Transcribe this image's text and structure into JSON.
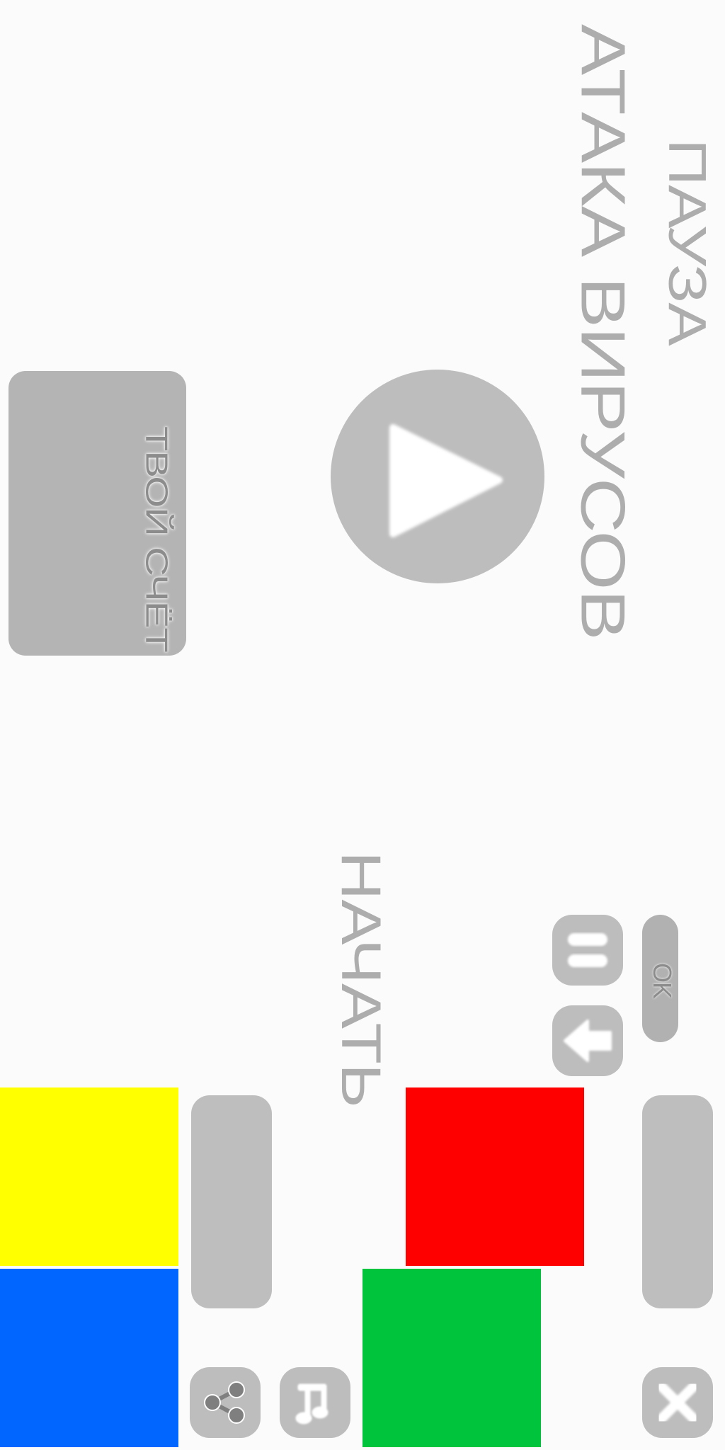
{
  "header": {
    "pause_title": "ПАУЗА",
    "game_title": "АТАКА ВИРУСОВ"
  },
  "score": {
    "label": "ТВОЙ СЧЁТ"
  },
  "start": {
    "label": "НАЧАТЬ"
  },
  "ok_button": {
    "label": "OK"
  },
  "icons": {
    "play": "play-icon",
    "pause": "pause-icon",
    "back": "back-arrow-icon",
    "share": "share-icon",
    "music": "music-note-icon",
    "close": "close-icon"
  },
  "colors": {
    "yellow": "#ffff00",
    "blue": "#0066ff",
    "red": "#ff0000",
    "green": "#00c43c",
    "button_gray": "#bdbdbd",
    "text_gray": "#adadad"
  }
}
